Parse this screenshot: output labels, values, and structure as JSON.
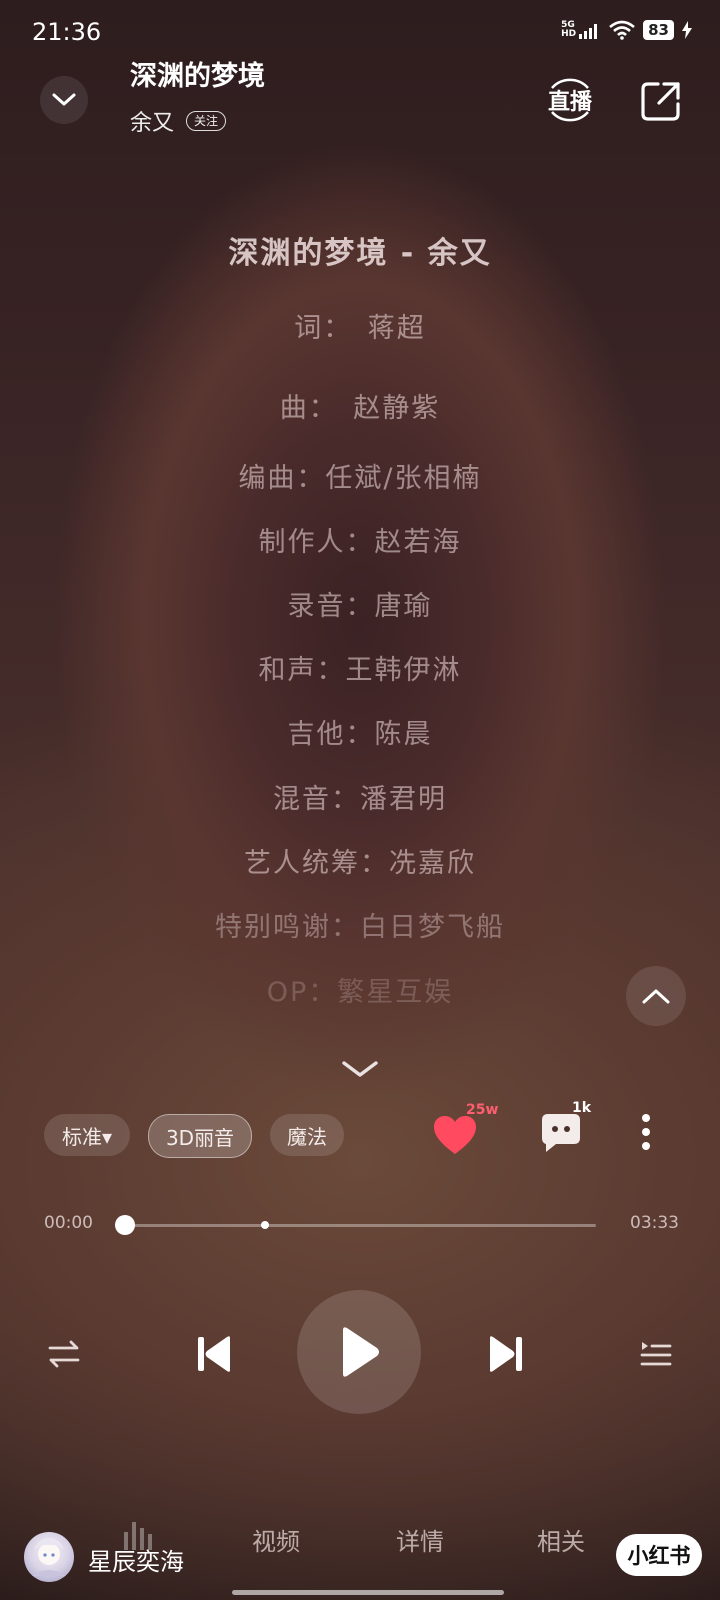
{
  "status_bar": {
    "time": "21:36",
    "signal_top": "5G",
    "signal_bottom": "HD",
    "battery": "83"
  },
  "header": {
    "song_title": "深渊的梦境",
    "artist": "余又",
    "follow_label": "关注",
    "live_label": "直播"
  },
  "lyrics": [
    {
      "text": "深渊的梦境 - 余又",
      "style": "title"
    },
    {
      "text": "词：　蒋超",
      "style": "normal"
    },
    {
      "text": "曲：　赵静紫",
      "style": "normal"
    },
    {
      "text": "编曲：任斌/张相楠",
      "style": "normal"
    },
    {
      "text": "制作人：赵若海",
      "style": "normal"
    },
    {
      "text": "录音：唐瑜",
      "style": "normal"
    },
    {
      "text": "和声：王韩伊淋",
      "style": "normal"
    },
    {
      "text": "吉他：陈晨",
      "style": "normal"
    },
    {
      "text": "混音：潘君明",
      "style": "normal"
    },
    {
      "text": "艺人统筹：冼嘉欣",
      "style": "normal"
    },
    {
      "text": "特别鸣谢：白日梦飞船",
      "style": "fade1"
    },
    {
      "text": "OP：繁星互娱",
      "style": "fade2"
    }
  ],
  "controls": {
    "quality_label": "标准▾",
    "sound_3d_label": "3D丽音",
    "magic_label": "魔法",
    "likes_count": "25w",
    "comments_count": "1k"
  },
  "progress": {
    "current_time": "00:00",
    "total_time": "03:33",
    "played_fraction": 0.0
  },
  "bottom_nav": {
    "channel_name": "星辰奕海",
    "tabs": [
      "视频",
      "详情",
      "相关"
    ],
    "app_badge": "小红书"
  },
  "colors": {
    "heart": "#ff4a5f",
    "background_dark": "#3a2425",
    "background_warm": "#6b4a3a"
  }
}
